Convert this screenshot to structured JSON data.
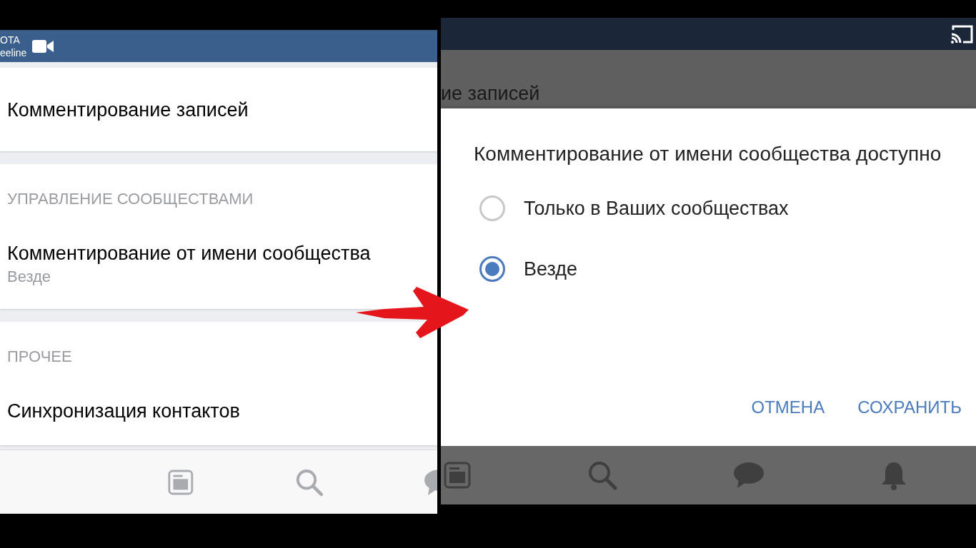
{
  "left_screen": {
    "status_bar": {
      "carrier_lines": [
        "OTA",
        "eeline"
      ]
    },
    "sections": [
      {
        "items": [
          {
            "title": "Комментирование записей"
          }
        ]
      },
      {
        "header": "УПРАВЛЕНИЕ СООБЩЕСТВАМИ",
        "items": [
          {
            "title": "Комментирование от имени сообщества",
            "value": "Везде"
          }
        ]
      },
      {
        "header": "ПРОЧЕЕ",
        "items": [
          {
            "title": "Синхронизация контактов"
          }
        ]
      }
    ]
  },
  "right_screen": {
    "background_text": "ие записей",
    "dialog": {
      "title": "Комментирование от имени сообщества доступно",
      "options": [
        {
          "label": "Только в Ваших сообществах",
          "selected": false
        },
        {
          "label": "Везде",
          "selected": true
        }
      ],
      "buttons": [
        "ОТМЕНА",
        "СОХРАНИТЬ"
      ]
    }
  }
}
